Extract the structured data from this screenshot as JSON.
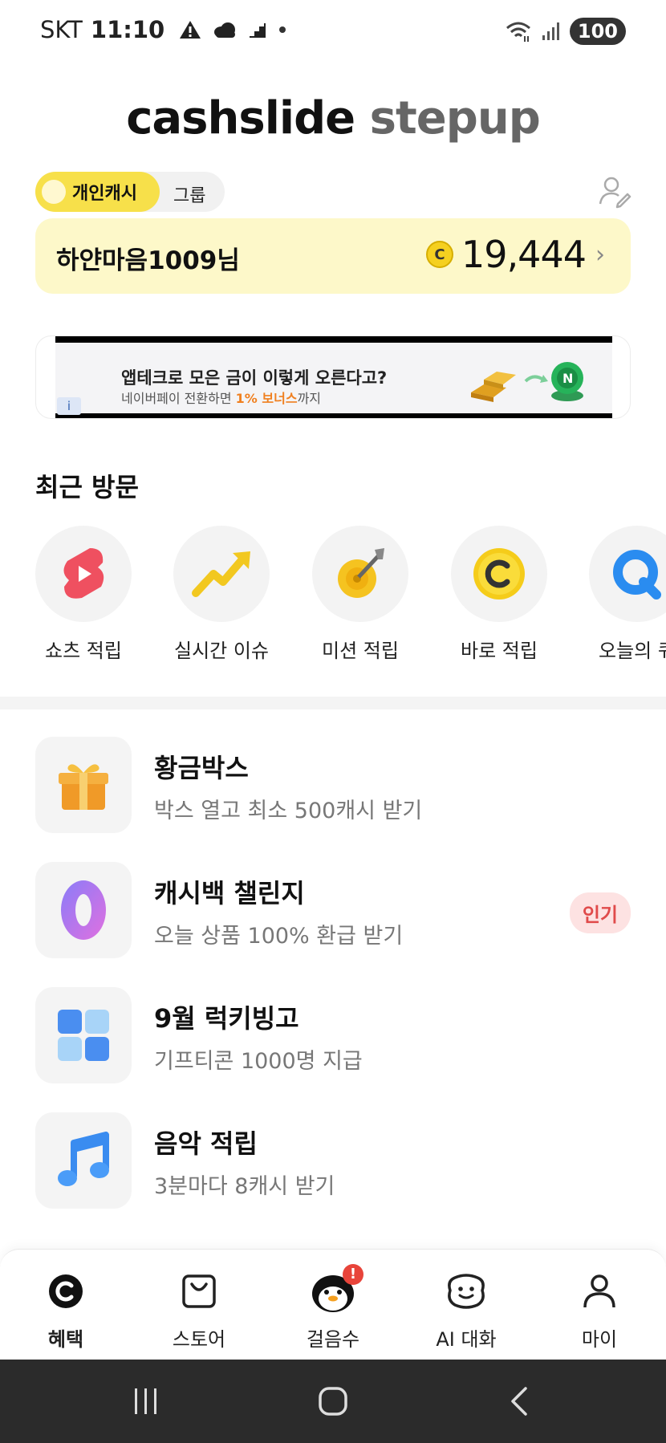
{
  "status_bar": {
    "carrier": "SKT",
    "time": "11:10",
    "battery": "100"
  },
  "logo": {
    "part1": "cashslide",
    "part2": "stepup"
  },
  "toggle": {
    "personal": "개인캐시",
    "group": "그룹"
  },
  "account": {
    "name": "하얀마음1009님",
    "coin_symbol": "C",
    "balance": "19,444"
  },
  "ad": {
    "title": "앱테크로 모은 금이 이렇게 오른다고?",
    "sub_prefix": "네이버페이 전환하면 ",
    "sub_highlight": "1% 보너스",
    "sub_suffix": "까지",
    "info": "i"
  },
  "recent": {
    "title": "최근 방문",
    "items": [
      {
        "label": "쇼츠 적립",
        "icon": "shorts-icon"
      },
      {
        "label": "실시간 이슈",
        "icon": "trend-arrow-icon"
      },
      {
        "label": "미션 적립",
        "icon": "target-icon"
      },
      {
        "label": "바로 적립",
        "icon": "coin-icon"
      },
      {
        "label": "오늘의 퀴",
        "icon": "quiz-icon"
      }
    ]
  },
  "list": [
    {
      "title": "황금박스",
      "sub": "박스 열고 최소 500캐시 받기",
      "icon": "gift-box-icon"
    },
    {
      "title": "캐시백 챌린지",
      "sub": "오늘 상품 100% 환급 받기",
      "icon": "zero-icon",
      "badge": "인기"
    },
    {
      "title": "9월 럭키빙고",
      "sub": "기프티콘 1000명 지급",
      "icon": "bingo-grid-icon"
    },
    {
      "title": "음악 적립",
      "sub": "3분마다 8캐시 받기",
      "icon": "music-note-icon"
    }
  ],
  "nav": [
    {
      "label": "혜택",
      "icon": "benefit-icon",
      "active": true
    },
    {
      "label": "스토어",
      "icon": "store-bag-icon"
    },
    {
      "label": "걸음수",
      "icon": "penguin-icon",
      "badge": "!"
    },
    {
      "label": "AI 대화",
      "icon": "ai-chat-icon"
    },
    {
      "label": "마이",
      "icon": "person-icon"
    }
  ],
  "colors": {
    "accent_yellow": "#f7e04a",
    "card_yellow": "#fdf8c9",
    "badge_red": "#e04a4a"
  }
}
